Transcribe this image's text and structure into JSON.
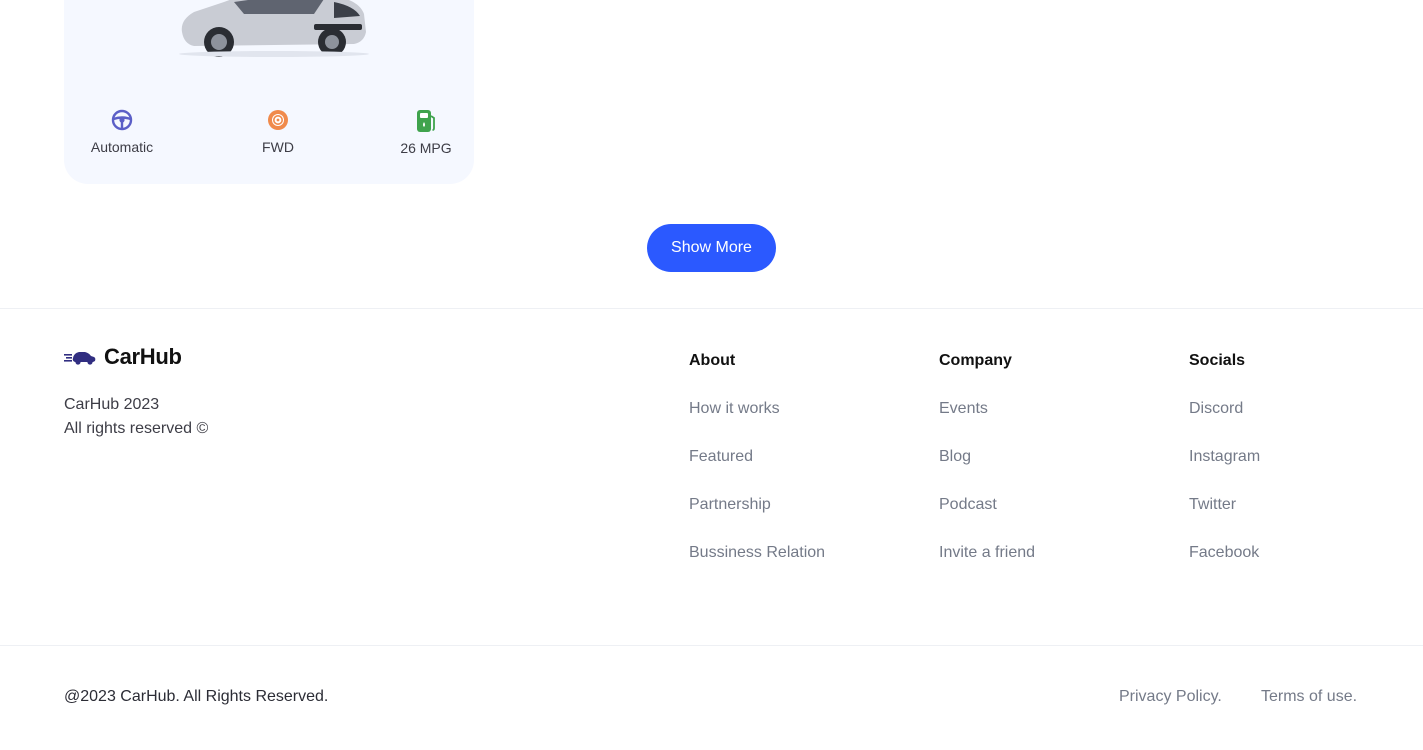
{
  "car_card": {
    "specs": [
      {
        "icon": "steering-wheel-icon",
        "label": "Automatic",
        "color": "#5b5fc7"
      },
      {
        "icon": "tire-icon",
        "label": "FWD",
        "color": "#f08a4b"
      },
      {
        "icon": "gas-pump-icon",
        "label": "26 MPG",
        "color": "#3fa34d"
      }
    ]
  },
  "show_more": {
    "label": "Show More",
    "color": "#2b59ff"
  },
  "footer": {
    "brand": {
      "name": "CarHub",
      "line1": "CarHub 2023",
      "line2": "All rights reserved ©",
      "logo_color": "#312e81"
    },
    "columns": [
      {
        "title": "About",
        "links": [
          "How it works",
          "Featured",
          "Partnership",
          "Bussiness Relation"
        ]
      },
      {
        "title": "Company",
        "links": [
          "Events",
          "Blog",
          "Podcast",
          "Invite a friend"
        ]
      },
      {
        "title": "Socials",
        "links": [
          "Discord",
          "Instagram",
          "Twitter",
          "Facebook"
        ]
      }
    ],
    "copyright": "@2023 CarHub. All Rights Reserved.",
    "privacy": "Privacy Policy.",
    "terms": "Terms of use."
  }
}
